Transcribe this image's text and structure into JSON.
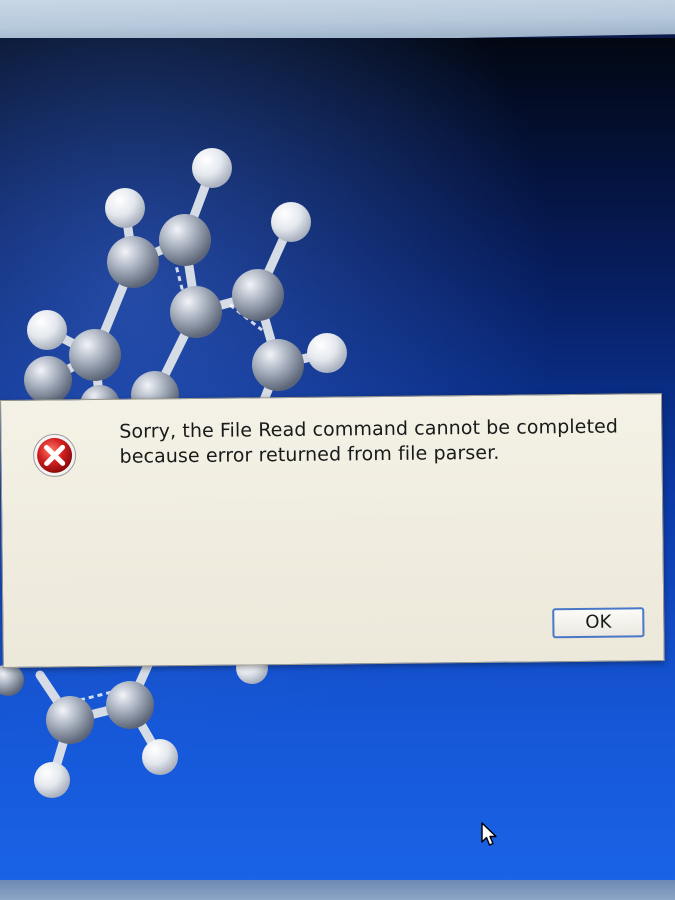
{
  "dialog": {
    "message_line1": "Sorry, the File Read command cannot be completed",
    "message_line2": "because error returned from file parser.",
    "icon": "error-icon",
    "ok_label": "OK"
  },
  "desktop": {
    "wallpaper": "molecule-ball-and-stick",
    "colors": {
      "wallpaper_top": "#020712",
      "wallpaper_bottom": "#1a63e6",
      "dialog_bg": "#ece8da",
      "error_red": "#d21f1f",
      "button_border": "#4a78c8"
    }
  },
  "pointer": {
    "icon": "mouse-pointer-icon"
  }
}
